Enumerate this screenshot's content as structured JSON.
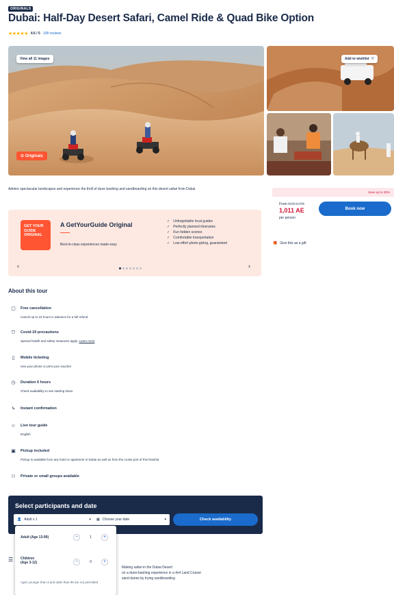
{
  "product": {
    "badge": "ORIGINALS",
    "title": "Dubai: Half-Day Desert Safari, Camel Ride & Quad Bike Option",
    "stars": "★★★★★",
    "rating": "4.6 / 5",
    "reviews": "108 reviews"
  },
  "gallery": {
    "view_all": "View all 11 images",
    "wishlist": "Add to wishlist",
    "originals_tag": "Originals"
  },
  "description": "Admire spectacular landscapes and experience the thrill of dune bashing and sandboarding on this desert safari from Dubai.",
  "price": {
    "banner": "Save up to 30%",
    "from_label": "From",
    "old_price": "AED 1,445",
    "price": "1,011 AE",
    "per_person": "per person",
    "book_label": "Book now",
    "gift_label": "Give this as a gift"
  },
  "originals_card": {
    "logo_text": "GET YOUR GUIDE ORIGINAL",
    "title": "A GetYourGuide Original",
    "subtitle": "Best-in-class experiences made easy",
    "features": [
      "Unforgettable local guides",
      "Perfectly planned itineraries",
      "Fun hidden scenes",
      "Comfortable transportation",
      "Low-effort photo-giving, guaranteed"
    ]
  },
  "about": {
    "title": "About this tour",
    "items": [
      {
        "icon": "calendar-icon",
        "title": "Free cancellation",
        "desc": "Cancel up to 24 hours in advance for a full refund"
      },
      {
        "icon": "shield-icon",
        "title": "Covid-19 precautions",
        "desc": "Special health and safety measures apply.",
        "link": "Learn more"
      },
      {
        "icon": "phone-icon",
        "title": "Mobile ticketing",
        "desc": "Use your phone or print your voucher"
      },
      {
        "icon": "clock-icon",
        "title": "Duration 6 hours",
        "desc": "Check availability to see starting times"
      },
      {
        "icon": "lightning-icon",
        "title": "Instant confirmation",
        "desc": ""
      },
      {
        "icon": "guide-icon",
        "title": "Live tour guide",
        "desc": "English"
      },
      {
        "icon": "bus-icon",
        "title": "Pickup included",
        "desc": "Pickup is available from any hotel or apartment in Dubai as well as from the cruise port of Port Rashid"
      },
      {
        "icon": "group-icon",
        "title": "Private or small groups available",
        "desc": ""
      }
    ]
  },
  "select": {
    "title": "Select participants and date",
    "participants": "Adult x 1",
    "date_placeholder": "Choose your date",
    "check_label": "Check availability"
  },
  "dropdown": {
    "adult_label": "Adult",
    "adult_age": "(Age 13-99)",
    "adult_count": "1",
    "child_label": "Children",
    "child_age": "(Age 3-12)",
    "child_count": "0",
    "note": "Ages younger than 3 and older than 99 are not permitted"
  },
  "highlights": {
    "lines": [
      "Making safari in the Dubai Desert",
      "on a dune-bashing experience in a 4x4 Land Cruiser",
      "sand dunes by trying sandboarding"
    ]
  }
}
